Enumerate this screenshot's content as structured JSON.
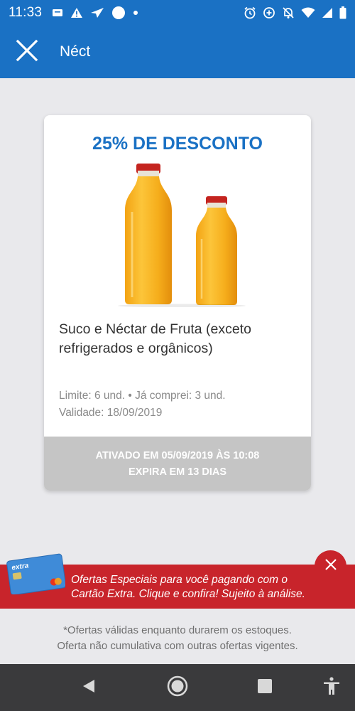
{
  "status_bar": {
    "time": "11:33",
    "left_icons": [
      "sim-card-icon",
      "warning-icon",
      "send-icon",
      "circle-icon",
      "dot-icon"
    ],
    "right_icons": [
      "alarm-icon",
      "data-saver-icon",
      "notifications-off-icon",
      "wifi-icon",
      "signal-icon",
      "battery-icon"
    ]
  },
  "app_bar": {
    "title": "Néct",
    "close_icon": "close-icon"
  },
  "offer": {
    "discount": "25% DE DESCONTO",
    "product_name": "Suco e Néctar de Fruta (exceto refrigerados e orgânicos)",
    "limit": "Limite:  6 und. • Já comprei: 3 und.",
    "validity": "Validade:  18/09/2019",
    "activated": "ATIVADO EM 05/09/2019 ÀS 10:08",
    "expires": "EXPIRA EM 13 DIAS"
  },
  "promo_banner": {
    "line1": "Ofertas Especiais para você pagando com o",
    "line2": "Cartão Extra. Clique e confira! Sujeito à análise.",
    "card_brand": "extra"
  },
  "disclaimer": {
    "line1": "*Ofertas válidas enquanto durarem os estoques.",
    "line2": "Oferta não cumulativa com outras ofertas vigentes."
  },
  "colors": {
    "primary": "#1a71c4",
    "promo_red": "#c8242b",
    "band_gray": "#c5c5c5",
    "nav_bar": "#3a3a3c"
  }
}
